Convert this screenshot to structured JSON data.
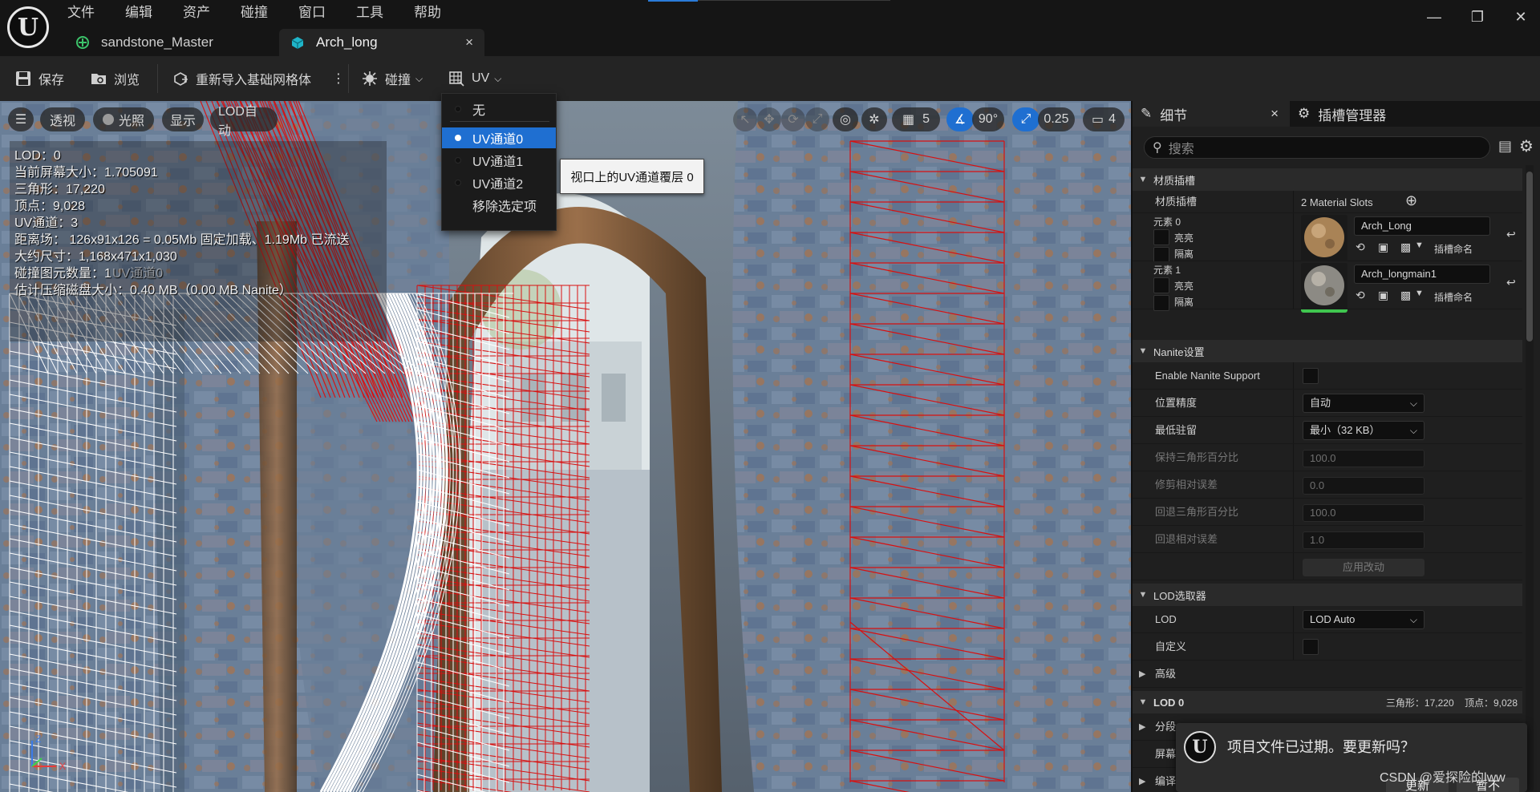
{
  "app": {
    "logo_letter": "U"
  },
  "menu": [
    "文件",
    "编辑",
    "资产",
    "碰撞",
    "窗口",
    "工具",
    "帮助"
  ],
  "window_controls": {
    "minimize": "—",
    "maximize": "❐",
    "close": "✕"
  },
  "tabs": [
    {
      "label": "sandstone_Master",
      "active": false
    },
    {
      "label": "Arch_long",
      "active": true,
      "close": "×"
    }
  ],
  "toolbar": {
    "save": "保存",
    "browse": "浏览",
    "reimport": "重新导入基础网格体",
    "more": "⋮",
    "collision": "碰撞",
    "uv": "UV"
  },
  "viewport": {
    "pills": {
      "menu": "☰",
      "perspective": "透视",
      "lighting": "光照",
      "show": "显示",
      "lod": "LOD自动",
      "grid_snap": "5",
      "rotate_snap": "90°",
      "scale_snap": "0.25",
      "camera_speed": "4"
    },
    "stats": [
      "LOD：0",
      "当前屏幕大小：1.705091",
      "三角形：17,220",
      "顶点：9,028",
      "UV通道：3",
      "距离场： 126x91x126 = 0.05Mb 固定加载、1.19Mb 已流送",
      "大约尺寸：1,168x471x1,030",
      "碰撞图元数量：1",
      "估计压缩磁盘大小：0.40 MB（0.00 MB Nanite）"
    ],
    "overlay_ghost": "UV通道0",
    "axis": {
      "z": "Z",
      "x": "X"
    }
  },
  "uv_menu": {
    "items": [
      {
        "label": "无",
        "selected": false
      },
      {
        "label": "UV通道0",
        "selected": true
      },
      {
        "label": "UV通道1",
        "selected": false
      },
      {
        "label": "UV通道2",
        "selected": false
      },
      {
        "label": "移除选定项",
        "selected": false
      }
    ],
    "tooltip": "视口上的UV通道覆层 0"
  },
  "details": {
    "tabs": {
      "details": "细节",
      "details_close": "×",
      "socket_manager": "插槽管理器"
    },
    "search_placeholder": "搜索",
    "material_section": "材质插槽",
    "material_slots_label": "材质插槽",
    "material_slots_value": "2 Material Slots",
    "elements": [
      {
        "label": "元素 0",
        "highlight": "亮亮",
        "isolate": "隔离",
        "material": "Arch_Long",
        "slot_name": "插槽命名"
      },
      {
        "label": "元素 1",
        "highlight": "亮亮",
        "isolate": "隔离",
        "material": "Arch_longmain1",
        "slot_name": "插槽命名"
      }
    ],
    "nanite_section": "Nanite设置",
    "nanite_rows": {
      "enable": "Enable Nanite Support",
      "position_precision": "位置精度",
      "position_precision_value": "自动",
      "min_residency": "最低驻留",
      "min_residency_value": "最小（32 KB）",
      "keep_percent": "保持三角形百分比",
      "keep_percent_value": "100.0",
      "trim_error": "修剪相对误差",
      "trim_error_value": "0.0",
      "fallback_percent": "回退三角形百分比",
      "fallback_percent_value": "100.0",
      "fallback_error": "回退相对误差",
      "fallback_error_value": "1.0",
      "apply": "应用改动"
    },
    "lod_picker_section": "LOD选取器",
    "lod_label": "LOD",
    "lod_value": "LOD Auto",
    "custom_label": "自定义",
    "advanced": "高级",
    "lod0_section": "LOD 0",
    "lod0_stats": "三角形：17,220    顶点：9,028",
    "cut_rows": [
      "分段",
      "屏幕",
      "编译设置"
    ]
  },
  "notification": {
    "logo_letter": "U",
    "text": "项目文件已过期。要更新吗？",
    "update": "更新",
    "not_now": "暂不"
  },
  "watermark": "CSDN @爱探险的lww",
  "colors": {
    "accent": "#1f6fd1",
    "wire_red": "#d81010",
    "panel_bg": "#1f1f1f"
  }
}
